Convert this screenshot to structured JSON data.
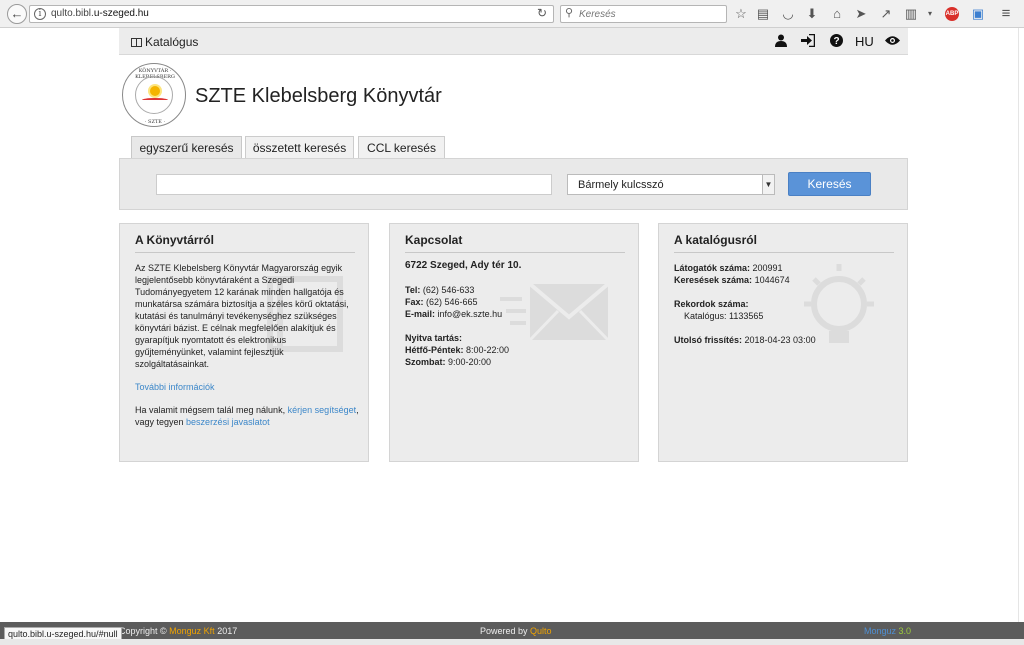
{
  "browser": {
    "url_host": "qulto.bibl.",
    "url_domain": "u-szeged.hu",
    "search_placeholder": "Keresés",
    "toolbar_icons": [
      "star-icon",
      "reader-icon",
      "pocket-icon",
      "download-icon",
      "home-icon",
      "send-icon",
      "share-icon",
      "trash-icon",
      "adblock-icon",
      "note-icon",
      "menu-icon"
    ],
    "adblock_label": "ABP"
  },
  "navbar": {
    "brand": "Katalógus",
    "icons": [
      "user-icon",
      "login-icon",
      "help-icon",
      "eye-icon"
    ],
    "lang": "HU"
  },
  "header": {
    "title": "SZTE Klebelsberg Könyvtár",
    "logo_top_text": "KÖNYVTÁR · KLEBELSBERG",
    "logo_bottom_text": "· SZTE ·"
  },
  "tabs": [
    {
      "label": "egyszerű keresés",
      "active": true
    },
    {
      "label": "összetett keresés",
      "active": false
    },
    {
      "label": "CCL keresés",
      "active": false
    }
  ],
  "search": {
    "query_value": "",
    "select_value": "Bármely kulcsszó",
    "button_label": "Keresés"
  },
  "panels": {
    "about": {
      "title": "A Könyvtárról",
      "text": "Az SZTE Klebelsberg Könyvtár Magyarország egyik legjelentősebb könyvtáraként a Szegedi Tudományegyetem 12 karának minden hallgatója és munkatársa számára biztosítja a széles körű oktatási, kutatási és tanulmányi tevékenységhez szükséges könyvtári bázist. E célnak megfelelően alakítjuk és gyarapítjuk nyomtatott és elektronikus gyűjteményünket, valamint fejlesztjük szolgáltatásainkat.",
      "more_link": "További információk",
      "help_prefix": "Ha valamit mégsem talál meg nálunk, ",
      "help_link": "kérjen segítséget",
      "help_mid": ",",
      "help_line2_prefix": "vagy tegyen ",
      "suggest_link": "beszerzési javaslatot"
    },
    "contact": {
      "title": "Kapcsolat",
      "address": "6722 Szeged, Ady tér 10.",
      "tel_label": "Tel:",
      "tel": " (62) 546-633",
      "fax_label": "Fax:",
      "fax": " (62) 546-665",
      "email_label": "E-mail:",
      "email": " info@ek.szte.hu",
      "hours_title": "Nyitva tartás:",
      "weekday_label": "Hétfő-Péntek:",
      "weekday": " 8:00-22:00",
      "sat_label": "Szombat:",
      "sat": " 9:00-20:00"
    },
    "catalog": {
      "title": "A katalógusról",
      "visitors_label": "Látogatók száma:",
      "visitors": " 200991",
      "searches_label": "Keresések száma:",
      "searches": " 1044674",
      "records_label": "Rekordok száma:",
      "records_line": "Katalógus: 1133565",
      "updated_label": "Utolsó frissítés:",
      "updated": " 2018-04-23 03:00"
    }
  },
  "status_bar": {
    "link": "qulto.bibl.u-szeged.hu/#null"
  },
  "footer": {
    "copyright_prefix": "Copyright © ",
    "copyright_company": "Monguz Kft",
    "copyright_year": " 2017",
    "powered_prefix": "Powered by ",
    "powered_name": "Qulto",
    "version_name": "Monguz",
    "version_num": " 3.0"
  }
}
